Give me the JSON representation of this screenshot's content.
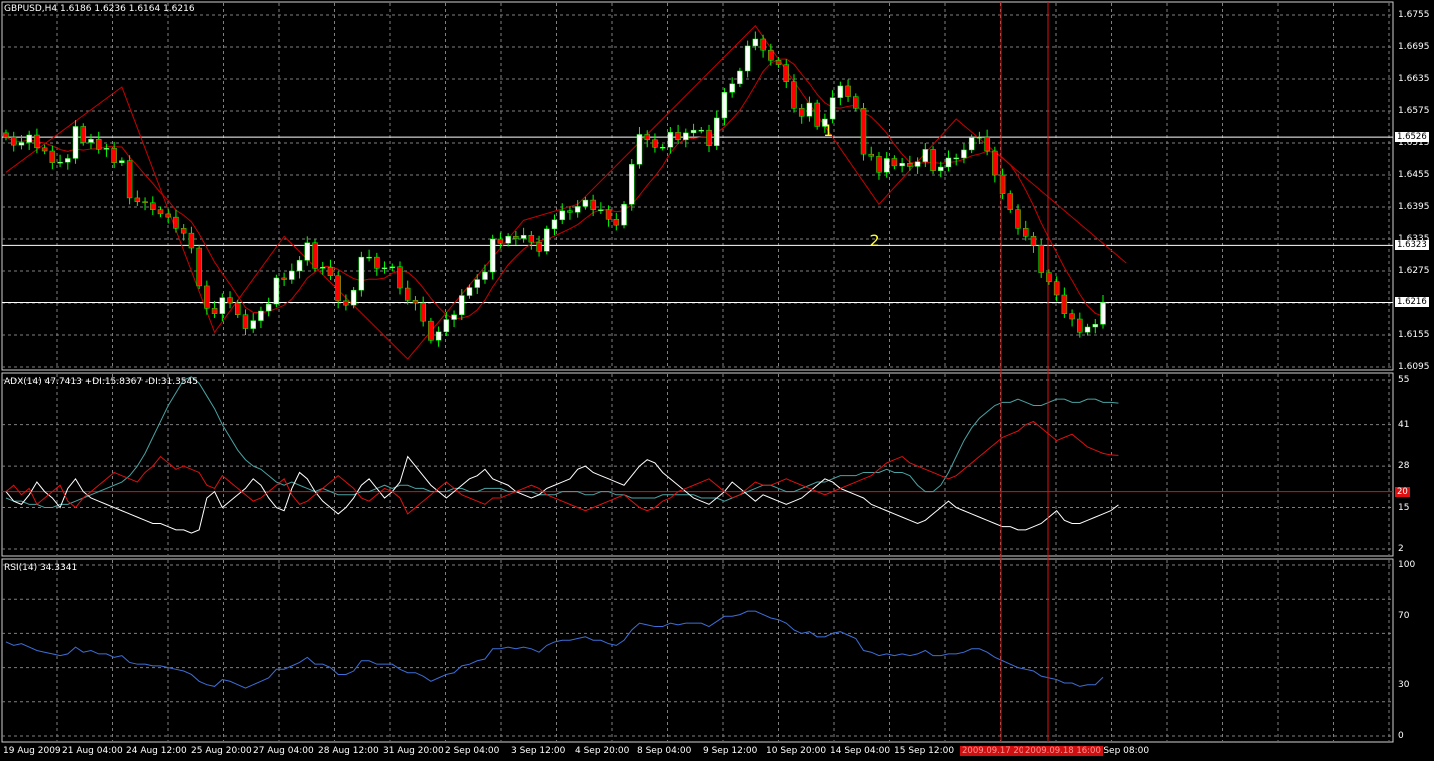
{
  "main": {
    "title": "GBPUSD,H4  1.6186 1.6236 1.6164 1.6216",
    "price_ticks": [
      "1.6755",
      "1.6695",
      "1.6635",
      "1.6575",
      "1.6515",
      "1.6455",
      "1.6395",
      "1.6335",
      "1.6275",
      "1.6215",
      "1.6155",
      "1.6095"
    ],
    "price_tags": [
      {
        "value": "1.6526",
        "price": 1.6526
      },
      {
        "value": "1.6323",
        "price": 1.6323
      },
      {
        "value": "1.6216",
        "price": 1.6216
      }
    ],
    "markers": [
      {
        "label": "1",
        "price": 1.6536,
        "bar": 105
      },
      {
        "label": "2",
        "price": 1.633,
        "bar": 111
      }
    ]
  },
  "adx_panel": {
    "title": "ADX(14) 47.7413 +DI:15.8367 -DI:31.3545",
    "ticks": [
      "55",
      "41",
      "28",
      "15",
      "2"
    ],
    "level_label": "20"
  },
  "rsi_panel": {
    "title": "RSI(14) 34.3341",
    "ticks": [
      "100",
      "70",
      "30",
      "0"
    ]
  },
  "time_axis": {
    "labels": [
      "19 Aug 2009",
      "21 Aug 04:00",
      "24 Aug 12:00",
      "25 Aug 20:00",
      "27 Aug 04:00",
      "28 Aug 12:00",
      "31 Aug 20:00",
      "2 Sep 04:00",
      "3 Sep 12:00",
      "4 Sep 20:00",
      "8 Sep 04:00",
      "9 Sep 12:00",
      "10 Sep 20:00",
      "14 Sep 04:00",
      "15 Sep 12:00",
      "21 Sep 08:00"
    ],
    "highlight_labels": [
      "2009.09.17 20:00",
      "2009.09.18 16:00"
    ]
  },
  "colors": {
    "bull": "#ffffff",
    "bear": "#ff0000",
    "wick": "#00ff00",
    "grid": "#7f7f7f",
    "zigzag": "#c80000",
    "adx": "#4aa3a3",
    "plus_di": "#ffffff",
    "minus_di": "#e01010",
    "rsi": "#3d6fd8",
    "marker": "#ffff30"
  },
  "chart_data": [
    {
      "type": "candlestick",
      "title": "GBPUSD,H4",
      "ylim": [
        1.6095,
        1.6755
      ],
      "close": [
        1.6526,
        1.6511,
        1.6516,
        1.653,
        1.6506,
        1.65,
        1.6478,
        1.6479,
        1.6486,
        1.6546,
        1.6516,
        1.6522,
        1.6503,
        1.6505,
        1.6478,
        1.6482,
        1.6412,
        1.6405,
        1.6403,
        1.639,
        1.6382,
        1.6376,
        1.6355,
        1.6346,
        1.6318,
        1.6247,
        1.6205,
        1.6195,
        1.6225,
        1.6215,
        1.6193,
        1.6167,
        1.6182,
        1.62,
        1.6213,
        1.6262,
        1.6259,
        1.6275,
        1.6295,
        1.6328,
        1.628,
        1.6282,
        1.6266,
        1.6219,
        1.6211,
        1.6239,
        1.6301,
        1.6301,
        1.628,
        1.6281,
        1.6283,
        1.6243,
        1.622,
        1.6215,
        1.6181,
        1.6145,
        1.6161,
        1.6184,
        1.6193,
        1.6229,
        1.6244,
        1.6259,
        1.6273,
        1.6335,
        1.6327,
        1.634,
        1.6336,
        1.6342,
        1.6329,
        1.6312,
        1.6354,
        1.6371,
        1.6388,
        1.6385,
        1.6396,
        1.6408,
        1.639,
        1.639,
        1.6372,
        1.6361,
        1.64,
        1.6475,
        1.6531,
        1.6521,
        1.6507,
        1.6507,
        1.6535,
        1.6521,
        1.6534,
        1.6539,
        1.6539,
        1.651,
        1.6562,
        1.661,
        1.6626,
        1.665,
        1.6697,
        1.671,
        1.6689,
        1.667,
        1.6662,
        1.663,
        1.658,
        1.6565,
        1.659,
        1.6546,
        1.656,
        1.66,
        1.6622,
        1.6602,
        1.658,
        1.6494,
        1.649,
        1.646,
        1.6486,
        1.6472,
        1.6477,
        1.6471,
        1.648,
        1.6503,
        1.6463,
        1.647,
        1.6487,
        1.6487,
        1.6502,
        1.6525,
        1.6526,
        1.65,
        1.6455,
        1.642,
        1.639,
        1.6355,
        1.634,
        1.6323,
        1.6272,
        1.6255,
        1.623,
        1.6195,
        1.6185,
        1.616,
        1.617,
        1.6175,
        1.6216
      ],
      "series": [
        {
          "name": "ADX(14)",
          "values": [
            18,
            17,
            17,
            16,
            16,
            15,
            15,
            16,
            16,
            17,
            18,
            19,
            20,
            21,
            22,
            23,
            25,
            28,
            32,
            37,
            42,
            47,
            51,
            55,
            56,
            54,
            50,
            46,
            41,
            37,
            33,
            30,
            28,
            27,
            25,
            23,
            22,
            23,
            22,
            21,
            20,
            21,
            20,
            19,
            19,
            19,
            20,
            20,
            21,
            22,
            21,
            22,
            22,
            21,
            21,
            20,
            20,
            20,
            21,
            21,
            20,
            20,
            21,
            21,
            21,
            20,
            20,
            20,
            20,
            19,
            19,
            19,
            20,
            20,
            20,
            19,
            19,
            20,
            20,
            19,
            19,
            18,
            18,
            18,
            18,
            19,
            19,
            19,
            19,
            19,
            18,
            18,
            18,
            17,
            18,
            19,
            20,
            21,
            22,
            22,
            21,
            20,
            20,
            21,
            22,
            23,
            23,
            24,
            25,
            25,
            25,
            26,
            26,
            26,
            27,
            26,
            26,
            25,
            22,
            20,
            20,
            22,
            26,
            31,
            36,
            40,
            43,
            45,
            47,
            48,
            48,
            49,
            48,
            47,
            47,
            48,
            49,
            49,
            48,
            48,
            49,
            49,
            48,
            48,
            47.7413
          ]
        },
        {
          "name": "+DI",
          "values": [
            20,
            17,
            16,
            19,
            23,
            20,
            18,
            15,
            21,
            24,
            20,
            18,
            17,
            16,
            15,
            14,
            13,
            12,
            11,
            10,
            10,
            9,
            8,
            8,
            7,
            8,
            18,
            20,
            15,
            17,
            19,
            21,
            24,
            22,
            18,
            15,
            14,
            21,
            26,
            24,
            20,
            17,
            15,
            13,
            15,
            18,
            22,
            24,
            21,
            18,
            20,
            23,
            31,
            28,
            25,
            22,
            20,
            18,
            20,
            22,
            24,
            25,
            27,
            24,
            23,
            22,
            20,
            19,
            18,
            19,
            21,
            22,
            23,
            24,
            27,
            28,
            26,
            25,
            24,
            23,
            22,
            25,
            28,
            30,
            29,
            26,
            24,
            22,
            20,
            18,
            17,
            16,
            18,
            20,
            23,
            21,
            19,
            17,
            19,
            18,
            17,
            16,
            17,
            18,
            20,
            22,
            24,
            23,
            21,
            20,
            19,
            18,
            16,
            15,
            14,
            13,
            12,
            11,
            10,
            11,
            13,
            15,
            17,
            15,
            14,
            13,
            12,
            11,
            10,
            9,
            9,
            8,
            8,
            9,
            10,
            12,
            14,
            11,
            10,
            10,
            11,
            12,
            13,
            14,
            15.8367
          ]
        },
        {
          "name": "-DI",
          "values": [
            20,
            22,
            19,
            21,
            16,
            18,
            20,
            22,
            17,
            15,
            18,
            20,
            22,
            24,
            26,
            25,
            24,
            23,
            26,
            28,
            31,
            29,
            27,
            28,
            27,
            26,
            22,
            21,
            25,
            23,
            21,
            19,
            17,
            18,
            20,
            22,
            24,
            19,
            16,
            17,
            19,
            21,
            23,
            25,
            23,
            21,
            18,
            17,
            19,
            21,
            20,
            18,
            13,
            15,
            17,
            19,
            21,
            23,
            21,
            19,
            18,
            17,
            16,
            18,
            18,
            19,
            20,
            21,
            22,
            21,
            19,
            18,
            17,
            16,
            15,
            14,
            15,
            16,
            17,
            18,
            19,
            17,
            15,
            14,
            15,
            17,
            18,
            20,
            21,
            22,
            23,
            24,
            22,
            20,
            18,
            19,
            21,
            23,
            22,
            22,
            23,
            24,
            23,
            22,
            21,
            20,
            19,
            20,
            21,
            22,
            23,
            24,
            25,
            27,
            29,
            30,
            31,
            29,
            28,
            27,
            26,
            25,
            24,
            25,
            27,
            29,
            31,
            33,
            35,
            37,
            38,
            39,
            41,
            42,
            40,
            38,
            36,
            37,
            38,
            36,
            34,
            33,
            32,
            31.5,
            31.3545
          ]
        },
        {
          "name": "RSI(14)",
          "values": [
            55,
            53,
            54,
            52,
            50,
            49,
            48,
            47,
            48,
            52,
            49,
            50,
            48,
            48,
            46,
            47,
            43,
            42,
            42,
            41,
            41,
            40,
            39,
            38,
            36,
            32,
            30,
            29,
            33,
            32,
            30,
            28,
            30,
            32,
            34,
            39,
            39,
            41,
            43,
            46,
            42,
            42,
            40,
            36,
            36,
            38,
            44,
            44,
            42,
            42,
            42,
            39,
            37,
            37,
            35,
            32,
            34,
            36,
            37,
            41,
            42,
            44,
            45,
            51,
            51,
            52,
            51,
            52,
            51,
            49,
            53,
            55,
            56,
            56,
            57,
            58,
            56,
            56,
            54,
            53,
            56,
            62,
            66,
            65,
            64,
            64,
            66,
            65,
            66,
            66,
            66,
            64,
            67,
            70,
            70,
            71,
            73,
            73,
            71,
            69,
            68,
            66,
            62,
            60,
            61,
            58,
            58,
            60,
            61,
            59,
            57,
            50,
            49,
            47,
            48,
            47,
            48,
            47,
            48,
            50,
            47,
            47,
            48,
            48,
            49,
            51,
            51,
            49,
            46,
            44,
            42,
            40,
            39,
            38,
            35,
            34,
            33,
            31,
            31,
            29,
            30,
            30,
            34.3341
          ]
        }
      ]
    }
  ]
}
